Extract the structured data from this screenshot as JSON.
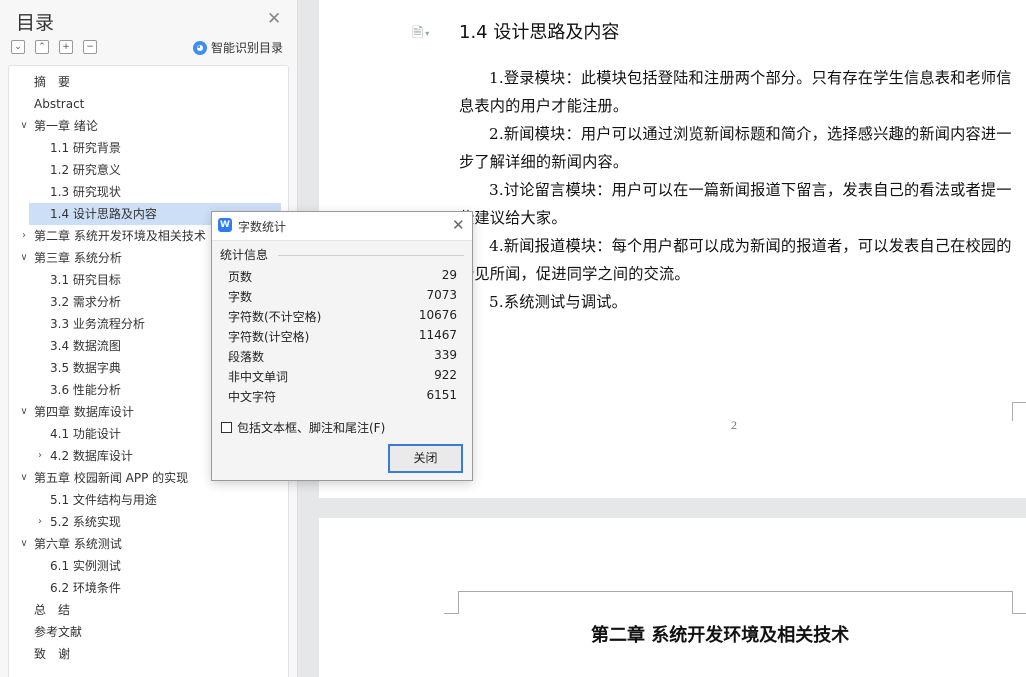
{
  "sidebar": {
    "title": "目录",
    "smart_identify": "智能识别目录",
    "toc": [
      {
        "label": "摘　要",
        "level": 0,
        "chevron": ""
      },
      {
        "label": "Abstract",
        "level": 0,
        "chevron": ""
      },
      {
        "label": "第一章  绪论",
        "level": 0,
        "chevron": "down"
      },
      {
        "label": "1.1  研究背景",
        "level": 1,
        "chevron": ""
      },
      {
        "label": "1.2  研究意义",
        "level": 1,
        "chevron": ""
      },
      {
        "label": "1.3 研究现状",
        "level": 1,
        "chevron": ""
      },
      {
        "label": "1.4 设计思路及内容",
        "level": 1,
        "chevron": "",
        "selected": true
      },
      {
        "label": "第二章  系统开发环境及相关技术",
        "level": 0,
        "chevron": "right"
      },
      {
        "label": "第三章  系统分析",
        "level": 0,
        "chevron": "down"
      },
      {
        "label": "3.1  研究目标",
        "level": 1,
        "chevron": ""
      },
      {
        "label": "3.2  需求分析",
        "level": 1,
        "chevron": ""
      },
      {
        "label": "3.3 业务流程分析",
        "level": 1,
        "chevron": ""
      },
      {
        "label": "3.4 数据流图",
        "level": 1,
        "chevron": ""
      },
      {
        "label": "3.5 数据字典",
        "level": 1,
        "chevron": ""
      },
      {
        "label": "3.6 性能分析",
        "level": 1,
        "chevron": ""
      },
      {
        "label": "第四章  数据库设计",
        "level": 0,
        "chevron": "down"
      },
      {
        "label": "4.1 功能设计",
        "level": 1,
        "chevron": ""
      },
      {
        "label": "4.2 数据库设计",
        "level": 1,
        "chevron": "right"
      },
      {
        "label": "第五章  校园新闻 APP 的实现",
        "level": 0,
        "chevron": "down"
      },
      {
        "label": "5.1  文件结构与用途",
        "level": 1,
        "chevron": ""
      },
      {
        "label": "5.2  系统实现",
        "level": 1,
        "chevron": "right"
      },
      {
        "label": "第六章  系统测试",
        "level": 0,
        "chevron": "down"
      },
      {
        "label": "6.1 实例测试",
        "level": 1,
        "chevron": ""
      },
      {
        "label": "6.2 环境条件",
        "level": 1,
        "chevron": ""
      },
      {
        "label": "总　结",
        "level": 0,
        "chevron": ""
      },
      {
        "label": "参考文献",
        "level": 0,
        "chevron": ""
      },
      {
        "label": "致　谢",
        "level": 0,
        "chevron": ""
      }
    ]
  },
  "document": {
    "section_title": "1.4 设计思路及内容",
    "paragraphs": [
      "1.登录模块：此模块包括登陆和注册两个部分。只有存在学生信息表和老师信息表内的用户才能注册。",
      "2.新闻模块：用户可以通过浏览新闻标题和简介，选择感兴趣的新闻内容进一步了解详细的新闻内容。",
      "3.讨论留言模块：用户可以在一篇新闻报道下留言，发表自己的看法或者提一些建议给大家。",
      "4.新闻报道模块：每个用户都可以成为新闻的报道者，可以发表自己在校园的所见所闻，促进同学之间的交流。",
      "5.系统测试与调试。"
    ],
    "page_number": "2",
    "next_chapter_title": "第二章  系统开发环境及相关技术"
  },
  "dialog": {
    "title": "字数统计",
    "section_label": "统计信息",
    "stats": [
      {
        "label": "页数",
        "value": "29"
      },
      {
        "label": "字数",
        "value": "7073"
      },
      {
        "label": "字符数(不计空格)",
        "value": "10676"
      },
      {
        "label": "字符数(计空格)",
        "value": "11467"
      },
      {
        "label": "段落数",
        "value": "339"
      },
      {
        "label": "非中文单词",
        "value": "922"
      },
      {
        "label": "中文字符",
        "value": "6151"
      }
    ],
    "checkbox_label": "包括文本框、脚注和尾注(F)",
    "close_button": "关闭"
  }
}
